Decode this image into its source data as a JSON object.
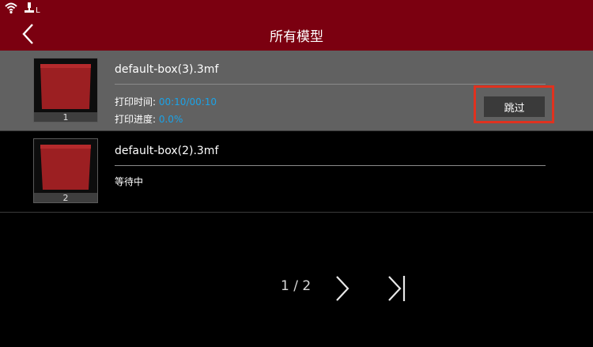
{
  "status_bar": {
    "wifi_icon": "wifi-icon",
    "usb_indicator": "L"
  },
  "header": {
    "title": "所有模型",
    "back_icon": "chevron-left-icon"
  },
  "models": [
    {
      "index": "1",
      "filename": "default-box(3).3mf",
      "time_label": "打印时间: ",
      "time_value": "00:10/00:10",
      "progress_label": "打印进度: ",
      "progress_value": "0.0%",
      "skip_label": "跳过"
    },
    {
      "index": "2",
      "filename": "default-box(2).3mf",
      "status": "等待中"
    }
  ],
  "pagination": {
    "text": "1 / 2",
    "next_icon": "chevron-right-icon",
    "last_icon": "skip-to-last-icon"
  },
  "colors": {
    "header": "#7b0010",
    "accent": "#1aa3e8",
    "highlight": "#e0321f",
    "model": "#9c1f22"
  }
}
